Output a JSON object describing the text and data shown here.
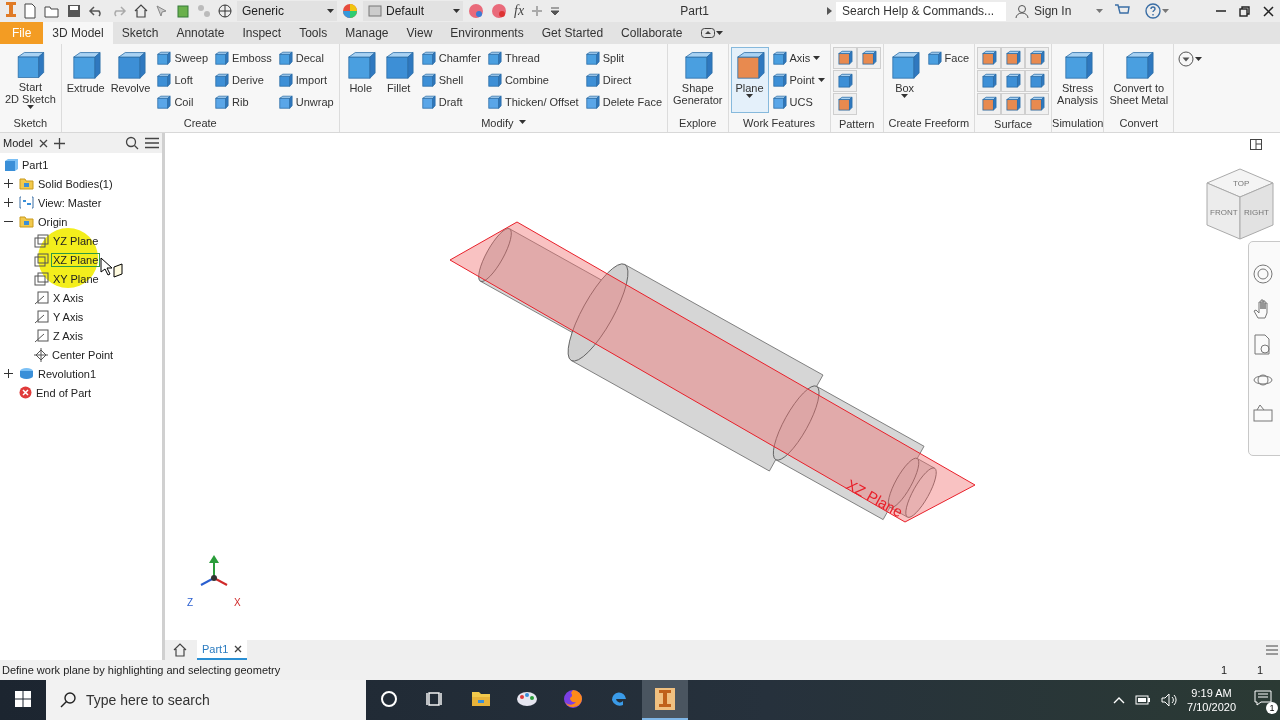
{
  "title_bar": {
    "material": "Generic",
    "appearance": "Default",
    "formula": "fx",
    "document_title": "Part1",
    "search": {
      "placeholder": "Search Help & Commands..."
    },
    "sign_in": "Sign In"
  },
  "tabs": [
    {
      "label": "File",
      "kind": "file",
      "selected": false
    },
    {
      "label": "3D Model",
      "kind": "tab",
      "selected": true
    },
    {
      "label": "Sketch",
      "kind": "tab",
      "selected": false
    },
    {
      "label": "Annotate",
      "kind": "tab",
      "selected": false
    },
    {
      "label": "Inspect",
      "kind": "tab",
      "selected": false
    },
    {
      "label": "Tools",
      "kind": "tab",
      "selected": false
    },
    {
      "label": "Manage",
      "kind": "tab",
      "selected": false
    },
    {
      "label": "View",
      "kind": "tab",
      "selected": false
    },
    {
      "label": "Environments",
      "kind": "tab",
      "selected": false
    },
    {
      "label": "Get Started",
      "kind": "tab",
      "selected": false
    },
    {
      "label": "Collaborate",
      "kind": "tab",
      "selected": false
    }
  ],
  "ribbon": [
    {
      "label": "Sketch",
      "dropdown": false,
      "columns": [
        {
          "kind": "large",
          "tools": [
            {
              "lines": [
                "Start",
                "2D Sketch"
              ],
              "dropdown": true,
              "selected": false
            }
          ]
        }
      ]
    },
    {
      "label": "Create",
      "dropdown": false,
      "columns": [
        {
          "kind": "large",
          "tools": [
            {
              "lines": [
                "Extrude"
              ],
              "dropdown": false,
              "selected": false
            }
          ]
        },
        {
          "kind": "large",
          "tools": [
            {
              "lines": [
                "Revolve"
              ],
              "dropdown": false,
              "selected": false
            }
          ]
        },
        {
          "kind": "stack",
          "tools": [
            {
              "lines": [
                "Sweep"
              ],
              "dropdown": false,
              "selected": false
            },
            {
              "lines": [
                "Loft"
              ],
              "dropdown": false,
              "selected": false
            },
            {
              "lines": [
                "Coil"
              ],
              "dropdown": false,
              "selected": false
            }
          ]
        },
        {
          "kind": "stack",
          "tools": [
            {
              "lines": [
                "Emboss"
              ],
              "dropdown": false,
              "selected": false
            },
            {
              "lines": [
                "Derive"
              ],
              "dropdown": false,
              "selected": false
            },
            {
              "lines": [
                "Rib"
              ],
              "dropdown": false,
              "selected": false
            }
          ]
        },
        {
          "kind": "stack",
          "tools": [
            {
              "lines": [
                "Decal"
              ],
              "dropdown": false,
              "selected": false
            },
            {
              "lines": [
                "Import"
              ],
              "dropdown": false,
              "selected": false
            },
            {
              "lines": [
                "Unwrap"
              ],
              "dropdown": false,
              "selected": false
            }
          ]
        }
      ]
    },
    {
      "label": "Modify",
      "dropdown": true,
      "columns": [
        {
          "kind": "large",
          "tools": [
            {
              "lines": [
                "Hole"
              ],
              "dropdown": false,
              "selected": false
            }
          ]
        },
        {
          "kind": "large",
          "tools": [
            {
              "lines": [
                "Fillet"
              ],
              "dropdown": false,
              "selected": false
            }
          ]
        },
        {
          "kind": "stack",
          "tools": [
            {
              "lines": [
                "Chamfer"
              ],
              "dropdown": false,
              "selected": false
            },
            {
              "lines": [
                "Shell"
              ],
              "dropdown": false,
              "selected": false
            },
            {
              "lines": [
                "Draft"
              ],
              "dropdown": false,
              "selected": false
            }
          ]
        },
        {
          "kind": "stack",
          "tools": [
            {
              "lines": [
                "Thread"
              ],
              "dropdown": false,
              "selected": false
            },
            {
              "lines": [
                "Combine"
              ],
              "dropdown": false,
              "selected": false
            },
            {
              "lines": [
                "Thicken/ Offset"
              ],
              "dropdown": false,
              "selected": false
            }
          ]
        },
        {
          "kind": "stack",
          "tools": [
            {
              "lines": [
                "Split"
              ],
              "dropdown": false,
              "selected": false
            },
            {
              "lines": [
                "Direct"
              ],
              "dropdown": false,
              "selected": false
            },
            {
              "lines": [
                "Delete Face"
              ],
              "dropdown": false,
              "selected": false
            }
          ]
        }
      ]
    },
    {
      "label": "Explore",
      "dropdown": false,
      "columns": [
        {
          "kind": "large",
          "tools": [
            {
              "lines": [
                "Shape",
                "Generator"
              ],
              "dropdown": false,
              "selected": false
            }
          ]
        }
      ]
    },
    {
      "label": "Work Features",
      "dropdown": false,
      "columns": [
        {
          "kind": "large",
          "tools": [
            {
              "lines": [
                "Plane"
              ],
              "dropdown": true,
              "selected": true
            }
          ]
        },
        {
          "kind": "stack",
          "tools": [
            {
              "lines": [
                "Axis"
              ],
              "dropdown": true,
              "selected": false
            },
            {
              "lines": [
                "Point"
              ],
              "dropdown": true,
              "selected": false
            },
            {
              "lines": [
                "UCS"
              ],
              "dropdown": false,
              "selected": false
            }
          ]
        }
      ]
    },
    {
      "label": "Pattern",
      "dropdown": false,
      "columns": [
        {
          "kind": "icon_stack"
        },
        {
          "kind": "icon_single"
        }
      ]
    },
    {
      "label": "Create Freeform",
      "dropdown": false,
      "columns": [
        {
          "kind": "large",
          "tools": [
            {
              "lines": [
                "Box"
              ],
              "dropdown": true,
              "selected": false
            }
          ]
        },
        {
          "kind": "stack",
          "tools": [
            {
              "lines": [
                "Face"
              ],
              "dropdown": false,
              "selected": false
            }
          ]
        }
      ]
    },
    {
      "label": "Surface",
      "dropdown": false,
      "columns": [
        {
          "kind": "icon_stack"
        },
        {
          "kind": "icon_stack"
        },
        {
          "kind": "icon_stack"
        }
      ]
    },
    {
      "label": "Simulation",
      "dropdown": false,
      "columns": [
        {
          "kind": "large",
          "tools": [
            {
              "lines": [
                "Stress",
                "Analysis"
              ],
              "dropdown": false,
              "selected": false
            }
          ]
        }
      ]
    },
    {
      "label": "Convert",
      "dropdown": false,
      "columns": [
        {
          "kind": "large",
          "tools": [
            {
              "lines": [
                "Convert to",
                "Sheet Metal"
              ],
              "dropdown": false,
              "selected": false
            }
          ]
        }
      ]
    }
  ],
  "browser": {
    "title": "Model",
    "tree": [
      {
        "label": "Part1",
        "kind": "part",
        "selected": false,
        "children": [
          {
            "label": "Solid Bodies(1)",
            "kind": "folder",
            "expanded": false,
            "selected": false
          },
          {
            "label": "View: Master",
            "kind": "view",
            "expanded": false,
            "selected": false
          },
          {
            "label": "Origin",
            "kind": "folder",
            "expanded": true,
            "selected": false,
            "children": [
              {
                "label": "YZ Plane",
                "kind": "plane",
                "selected": false
              },
              {
                "label": "XZ Plane",
                "kind": "plane",
                "selected": true
              },
              {
                "label": "XY Plane",
                "kind": "plane",
                "selected": false
              },
              {
                "label": "X Axis",
                "kind": "axis",
                "selected": false
              },
              {
                "label": "Y Axis",
                "kind": "axis",
                "selected": false
              },
              {
                "label": "Z Axis",
                "kind": "axis",
                "selected": false
              },
              {
                "label": "Center Point",
                "kind": "point",
                "selected": false
              }
            ]
          },
          {
            "label": "Revolution1",
            "kind": "feature",
            "expanded": false,
            "selected": false
          },
          {
            "label": "End of Part",
            "kind": "end",
            "selected": false
          }
        ]
      }
    ]
  },
  "viewport": {
    "plane_label": "XZ Plane",
    "triad": [
      "Z",
      "X"
    ],
    "view_cube": [
      "TOP",
      "FRONT",
      "RIGHT"
    ]
  },
  "document_tabs": [
    {
      "label": "Part1",
      "selected": true
    }
  ],
  "status_bar": {
    "message": "Define work plane by highlighting and selecting geometry",
    "counts": [
      "1",
      "1"
    ]
  },
  "taskbar": {
    "search_placeholder": "Type here to search",
    "apps": [
      {
        "kind": "cortana",
        "selected": false
      },
      {
        "kind": "task_view",
        "selected": false
      },
      {
        "kind": "explorer",
        "selected": false
      },
      {
        "kind": "paint",
        "selected": false
      },
      {
        "kind": "firefox",
        "selected": false
      },
      {
        "kind": "edge",
        "selected": false
      },
      {
        "kind": "inventor",
        "selected": true
      }
    ],
    "time": "9:19 AM",
    "date": "7/10/2020",
    "notifications": "1"
  }
}
